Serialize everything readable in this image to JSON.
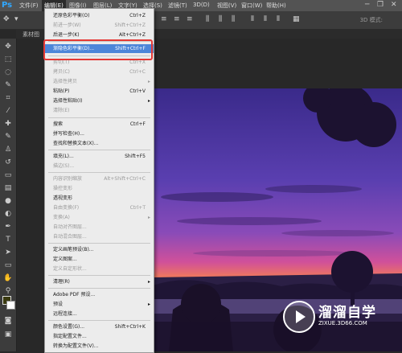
{
  "app": {
    "logo": "Ps"
  },
  "menubar": {
    "items": [
      "文件(F)",
      "编辑(E)",
      "图像(I)",
      "图层(L)",
      "文字(Y)",
      "选择(S)",
      "滤镜(T)",
      "3D(D)",
      "视图(V)",
      "窗口(W)",
      "帮助(H)"
    ],
    "active": "编辑(E)",
    "window_controls": [
      "minimize-icon",
      "restore-icon",
      "close-icon"
    ]
  },
  "options_bar": {
    "right_label": "3D 模式:"
  },
  "document": {
    "tab_label": "素材图"
  },
  "edit_menu": {
    "items": [
      {
        "label": "还原色彩平衡(O)",
        "shortcut": "Ctrl+Z",
        "disabled": false
      },
      {
        "label": "前进一步(W)",
        "shortcut": "Shift+Ctrl+Z",
        "disabled": true
      },
      {
        "label": "后退一步(K)",
        "shortcut": "Alt+Ctrl+Z",
        "disabled": false
      },
      {
        "label": "渐隐色彩平衡(D)...",
        "shortcut": "Shift+Ctrl+F",
        "disabled": false,
        "highlighted": true
      },
      {
        "label": "剪切(T)",
        "shortcut": "Ctrl+X",
        "disabled": true
      },
      {
        "label": "拷贝(C)",
        "shortcut": "Ctrl+C",
        "disabled": true
      },
      {
        "label": "选择性拷贝",
        "shortcut": "",
        "disabled": true,
        "submenu": true
      },
      {
        "label": "粘贴(P)",
        "shortcut": "Ctrl+V",
        "disabled": false
      },
      {
        "label": "选择性粘贴(I)",
        "shortcut": "",
        "disabled": false,
        "submenu": true
      },
      {
        "label": "清除(E)",
        "shortcut": "",
        "disabled": true
      },
      {
        "label": "搜索",
        "shortcut": "Ctrl+F",
        "disabled": false
      },
      {
        "label": "拼写检查(H)...",
        "shortcut": "",
        "disabled": false
      },
      {
        "label": "查找和替换文本(X)...",
        "shortcut": "",
        "disabled": false
      },
      {
        "label": "填充(L)...",
        "shortcut": "Shift+F5",
        "disabled": false
      },
      {
        "label": "描边(S)...",
        "shortcut": "",
        "disabled": true
      },
      {
        "label": "内容识别缩放",
        "shortcut": "Alt+Shift+Ctrl+C",
        "disabled": true
      },
      {
        "label": "操控变形",
        "shortcut": "",
        "disabled": true
      },
      {
        "label": "透视变形",
        "shortcut": "",
        "disabled": false
      },
      {
        "label": "自由变换(F)",
        "shortcut": "Ctrl+T",
        "disabled": true
      },
      {
        "label": "变换(A)",
        "shortcut": "",
        "disabled": true,
        "submenu": true
      },
      {
        "label": "自动对齐图层...",
        "shortcut": "",
        "disabled": true
      },
      {
        "label": "自动混合图层...",
        "shortcut": "",
        "disabled": true
      },
      {
        "label": "定义画笔预设(B)...",
        "shortcut": "",
        "disabled": false
      },
      {
        "label": "定义图案...",
        "shortcut": "",
        "disabled": false
      },
      {
        "label": "定义自定形状...",
        "shortcut": "",
        "disabled": true
      },
      {
        "label": "清理(R)",
        "shortcut": "",
        "disabled": false,
        "submenu": true
      },
      {
        "label": "Adobe PDF 预设...",
        "shortcut": "",
        "disabled": false
      },
      {
        "label": "预设",
        "shortcut": "",
        "disabled": false,
        "submenu": true
      },
      {
        "label": "远程连接...",
        "shortcut": "",
        "disabled": false
      },
      {
        "label": "颜色设置(G)...",
        "shortcut": "Shift+Ctrl+K",
        "disabled": false
      },
      {
        "label": "指定配置文件...",
        "shortcut": "",
        "disabled": false
      },
      {
        "label": "转换为配置文件(V)...",
        "shortcut": "",
        "disabled": false
      }
    ]
  },
  "watermark": {
    "title": "溜溜自学",
    "url": "ZIXUE.3D66.COM"
  },
  "colors": {
    "highlight": "#4d86d9",
    "annotation": "#e53935",
    "ps_blue": "#31a8ff"
  }
}
